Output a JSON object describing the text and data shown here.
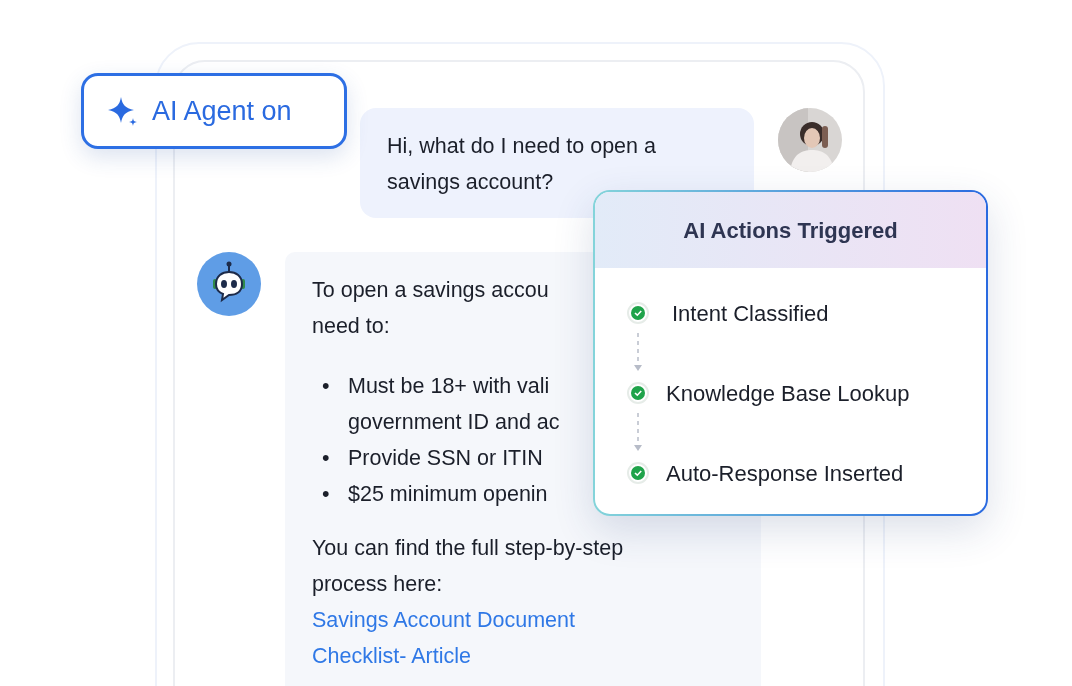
{
  "agent_badge": {
    "label": "AI Agent on"
  },
  "messages": [
    {
      "kind": "user",
      "lines": [
        "Hi, what do I need to open a",
        "savings account?"
      ]
    },
    {
      "kind": "bot",
      "intro": [
        "To open a savings accou",
        "need to:"
      ],
      "bullets": [
        {
          "marker": "•",
          "lines": [
            "Must be 18+ with vali",
            "government ID and ac"
          ]
        },
        {
          "marker": "•",
          "lines": [
            "Provide SSN or ITIN"
          ]
        },
        {
          "marker": "•",
          "lines": [
            "$25 minimum openin"
          ]
        }
      ],
      "outro": [
        "You can find the full step-by-step",
        "process here:"
      ],
      "link": "Savings Account Document Checklist- Article"
    }
  ],
  "actions_card": {
    "title": "AI Actions Triggered",
    "items": [
      {
        "label": "Intent Classified",
        "done": true
      },
      {
        "label": "Knowledge Base Lookup",
        "done": true
      },
      {
        "label": "Auto-Response Inserted",
        "done": true
      }
    ]
  }
}
